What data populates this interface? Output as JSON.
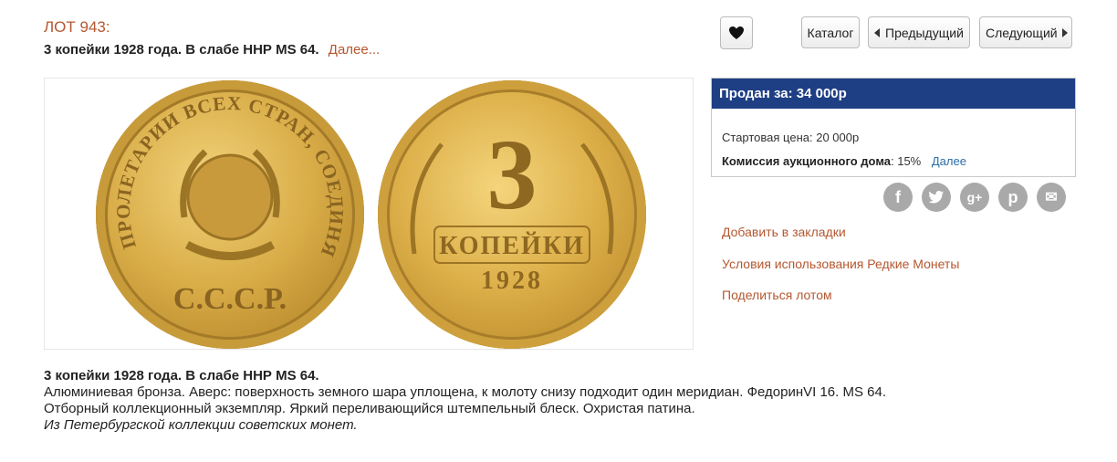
{
  "lot": {
    "number_label": "ЛОТ 943:",
    "title": "3 копейки 1928 года. В слабе ННР MS 64.",
    "more_label": "Далее..."
  },
  "toolbar": {
    "catalog_label": "Каталог",
    "prev_label": "Предыдущий",
    "next_label": "Следующий"
  },
  "coin_images": {
    "obverse_legend": "ПРОЛЕТАРИИ ВСЕХ СТРАН, СОЕДИНЯЙТЕСЬ!",
    "obverse_text": "С.С.С.Р.",
    "reverse_denomination": "3",
    "reverse_word": "КОПЕЙКИ",
    "reverse_year": "1928"
  },
  "price": {
    "sold_label": "Продан за: 34 000р",
    "start_label": "Стартовая цена:",
    "start_value": "20 000р",
    "commission_label": "Комиссия аукционного дома",
    "commission_value": ": 15%",
    "commission_more": "Далее"
  },
  "share": [
    {
      "icon": "facebook-icon",
      "glyph": "f"
    },
    {
      "icon": "twitter-icon",
      "glyph": "t"
    },
    {
      "icon": "google-plus-icon",
      "glyph": "g+"
    },
    {
      "icon": "pinterest-icon",
      "glyph": "p"
    },
    {
      "icon": "email-icon",
      "glyph": "✉"
    }
  ],
  "links": {
    "bookmark": "Добавить в закладки",
    "terms": "Условия использования Редкие Монеты",
    "share_lot": "Поделиться лотом"
  },
  "description": {
    "title": "3 копейки 1928 года. В слабе ННР MS 64.",
    "line1": "Алюминиевая бронза. Аверс: поверхность земного шара уплощена, к молоту снизу подходит один меридиан. ФедоринVI 16. MS 64.",
    "line2": "Отборный коллекционный экземпляр. Яркий переливающийся штемпельный блеск. Охристая патина.",
    "provenance": "Из Петербургской коллекции советских монет."
  },
  "colors": {
    "accent": "#b5572f",
    "price_header": "#1f3f85",
    "link_blue": "#2a6ea8",
    "share_icon_bg": "#a9a9a9"
  }
}
